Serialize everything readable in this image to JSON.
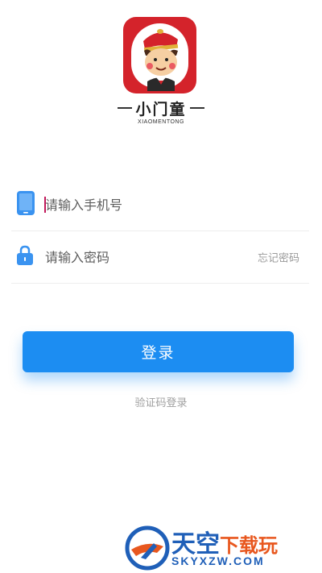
{
  "app": {
    "name": "小门童",
    "subtitle": "XIAOMENTONG"
  },
  "form": {
    "phone_placeholder": "请输入手机号",
    "password_placeholder": "请输入密码",
    "forgot_label": "忘记密码",
    "login_label": "登录",
    "sms_login_label": "验证码登录"
  },
  "watermark": {
    "title_main": "天空",
    "title_accent": "下载玩",
    "url": "SKYXZW.COM"
  },
  "colors": {
    "accent": "#1c8df2",
    "logo_red": "#d4232b",
    "watermark_blue": "#1f5fb8",
    "watermark_orange": "#e8571e"
  }
}
